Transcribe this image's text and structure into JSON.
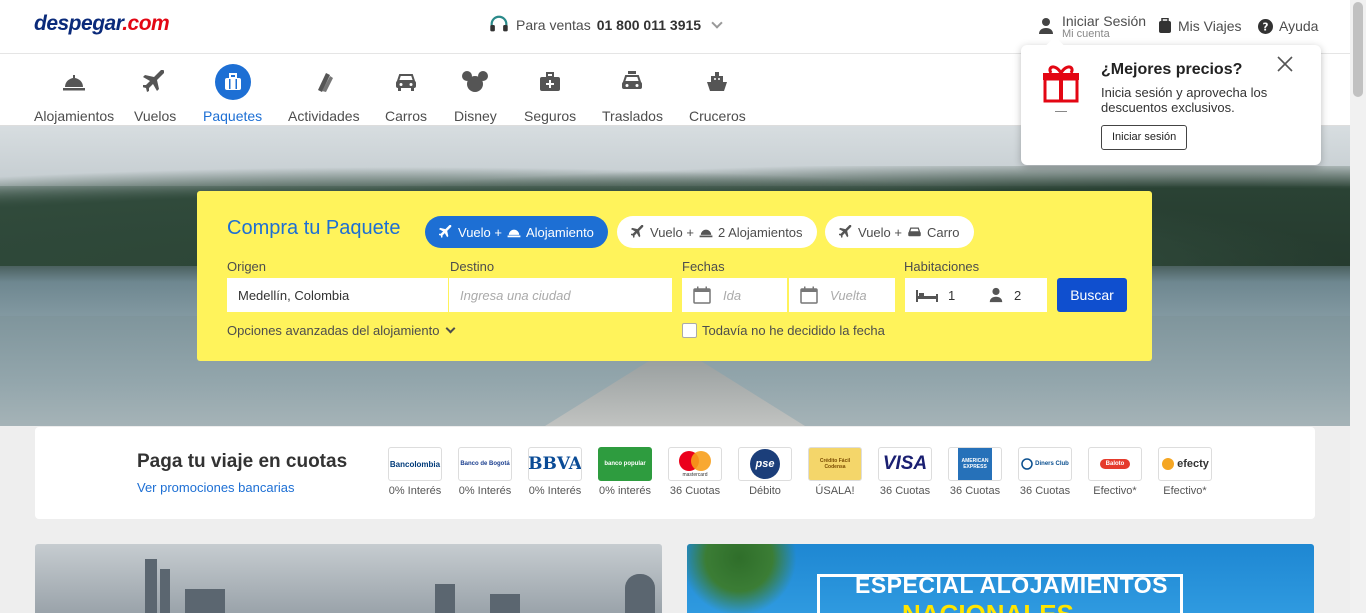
{
  "header": {
    "logo_text": "despegar",
    "logo_suffix": ".com",
    "phone_label": "Para ventas",
    "phone_number": "01 800 011 3915",
    "login_label": "Iniciar Sesión",
    "login_sub": "Mi cuenta",
    "trips_label": "Mis Viajes",
    "help_label": "Ayuda"
  },
  "nav": {
    "items": [
      {
        "label": "Alojamientos",
        "icon": "hotel-bell-icon"
      },
      {
        "label": "Vuelos",
        "icon": "airplane-icon"
      },
      {
        "label": "Paquetes",
        "icon": "suitcase-icon",
        "active": true
      },
      {
        "label": "Actividades",
        "icon": "tickets-icon"
      },
      {
        "label": "Carros",
        "icon": "car-icon"
      },
      {
        "label": "Disney",
        "icon": "mickey-icon"
      },
      {
        "label": "Seguros",
        "icon": "medical-kit-icon"
      },
      {
        "label": "Traslados",
        "icon": "taxi-icon"
      },
      {
        "label": "Cruceros",
        "icon": "ship-icon"
      }
    ]
  },
  "popup": {
    "title": "¿Mejores precios?",
    "text": "Inicia sesión y aprovecha los descuentos exclusivos.",
    "button": "Iniciar sesión"
  },
  "search": {
    "title": "Compra tu Paquete",
    "pills": [
      {
        "label": "Vuelo + ",
        "label2": "Alojamiento",
        "active": true
      },
      {
        "label": "Vuelo + ",
        "label2": "2 Alojamientos",
        "active": false
      },
      {
        "label": "Vuelo + ",
        "label2": "Carro",
        "active": false
      }
    ],
    "origin_label": "Origen",
    "origin_value": "Medellín, Colombia",
    "dest_label": "Destino",
    "dest_placeholder": "Ingresa una ciudad",
    "dates_label": "Fechas",
    "date_from_placeholder": "Ida",
    "date_to_placeholder": "Vuelta",
    "rooms_label": "Habitaciones",
    "rooms_value": "1",
    "guests_value": "2",
    "search_button": "Buscar",
    "advanced_label": "Opciones avanzadas del alojamiento",
    "no_date_label": "Todavía no he decidido la fecha"
  },
  "payments": {
    "title": "Paga tu viaje en cuotas",
    "link": "Ver promociones bancarias",
    "cards": [
      {
        "brand": "Bancolombia",
        "caption": "0% Interés",
        "color": "#003b7a"
      },
      {
        "brand": "Banco de Bogotá",
        "caption": "0% Interés",
        "color": "#1b3f8f"
      },
      {
        "brand": "BBVA",
        "caption": "0% Interés",
        "color": "#0a4b96"
      },
      {
        "brand": "banco popular",
        "caption": "0% interés",
        "color": "#2e9c3f"
      },
      {
        "brand": "mastercard",
        "caption": "36 Cuotas",
        "color": "#eb001b"
      },
      {
        "brand": "pse",
        "caption": "Débito",
        "color": "#1b3e7a"
      },
      {
        "brand": "Crédito Fácil Codensa",
        "caption": "ÚSALA!",
        "color": "#e8b52b"
      },
      {
        "brand": "VISA",
        "caption": "36 Cuotas",
        "color": "#1a1f71"
      },
      {
        "brand": "AMERICAN EXPRESS",
        "caption": "36 Cuotas",
        "color": "#2671b9"
      },
      {
        "brand": "Diners Club",
        "caption": "36 Cuotas",
        "color": "#0a4f8f"
      },
      {
        "brand": "Baloto",
        "caption": "Efectivo*",
        "color": "#e53b2c"
      },
      {
        "brand": "efecty",
        "caption": "Efectivo*",
        "color": "#333333"
      }
    ]
  },
  "promos": {
    "right_title": "ESPECIAL ALOJAMIENTOS",
    "right_sub": "NACIONALES"
  },
  "colors": {
    "accent": "#1d6fd4",
    "search_bg": "#fff35b",
    "button": "#0f4fcf",
    "brand_red": "#e30613"
  }
}
